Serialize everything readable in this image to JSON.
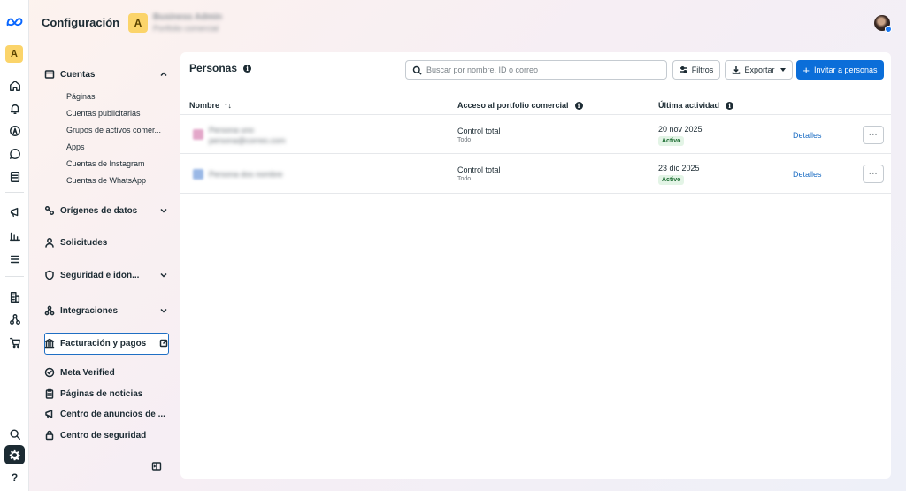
{
  "app": {
    "title": "Configuración",
    "business_initial": "A",
    "business_name": "Business Admin",
    "business_sub": "Portfolio comercial"
  },
  "rail": {
    "account_initial": "A",
    "help_label": "?"
  },
  "sidebar": {
    "cuentas": {
      "label": "Cuentas",
      "items": [
        "Páginas",
        "Cuentas publicitarias",
        "Grupos de activos comer...",
        "Apps",
        "Cuentas de Instagram",
        "Cuentas de WhatsApp"
      ]
    },
    "origenes": "Orígenes de datos",
    "solicitudes": "Solicitudes",
    "seguridad": "Seguridad e idon...",
    "integraciones": "Integraciones",
    "facturacion": "Facturación y pagos",
    "meta_verified": "Meta Verified",
    "paginas_noticias": "Páginas de noticias",
    "centro_anuncios": "Centro de anuncios de ...",
    "centro_seguridad": "Centro de seguridad"
  },
  "main": {
    "title": "Personas",
    "search_placeholder": "Buscar por nombre, ID o correo",
    "filters_label": "Filtros",
    "export_label": "Exportar",
    "invite_label": "Invitar a personas",
    "columns": {
      "name": "Nombre",
      "access": "Acceso al portfolio comercial",
      "activity": "Última actividad"
    },
    "rows": [
      {
        "name": "Persona uno",
        "email": "persona@correo.com",
        "access": "Control total",
        "access_sub": "Todo",
        "date": "20 nov 2025",
        "status": "Activo",
        "details": "Detalles",
        "more": "···"
      },
      {
        "name": "Persona dos nombre",
        "email": "",
        "access": "Control total",
        "access_sub": "Todo",
        "date": "23 dic 2025",
        "status": "Activo",
        "details": "Detalles",
        "more": "···"
      }
    ]
  }
}
